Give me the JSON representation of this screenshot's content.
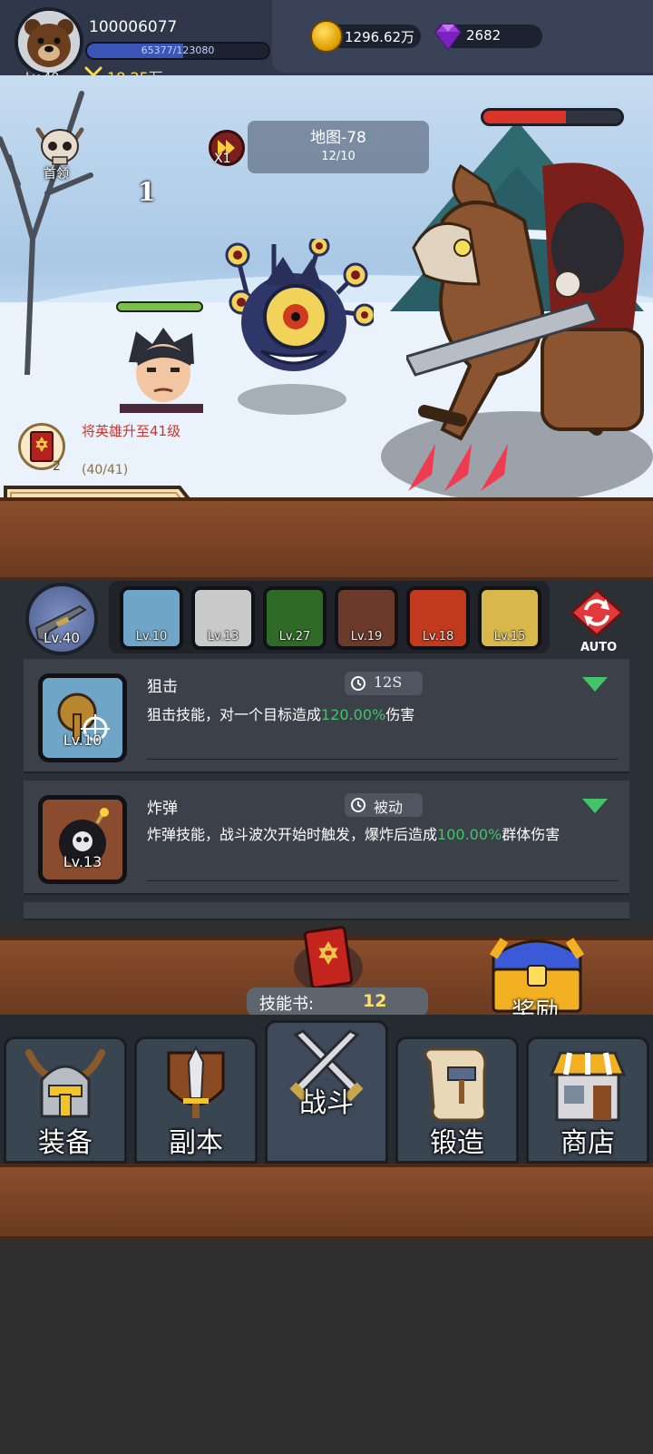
{
  "player": {
    "id": "100006077",
    "level": "Lv.40",
    "exp_text": "65377/123080",
    "exp_fraction": 0.531,
    "power": "18.25万"
  },
  "currency": {
    "gold": "1296.62万",
    "gems": "2682"
  },
  "battle": {
    "boss_label": "首领",
    "wave": "1",
    "speed": "X1",
    "map_title": "地图-78",
    "map_progress": "12/10",
    "boss_hp_fraction": 0.6,
    "hero_hp_fraction": 1.0
  },
  "quest": {
    "text": "将英雄升至41级",
    "progress": "(40/41)",
    "count": "2"
  },
  "skills_bar": {
    "weapon_level": "Lv.40",
    "slots": [
      {
        "level": "Lv.10",
        "color": "#6fa6c8"
      },
      {
        "level": "Lv.13",
        "color": "#c9c9c9"
      },
      {
        "level": "Lv.27",
        "color": "#2f6b26"
      },
      {
        "level": "Lv.19",
        "color": "#6b3a2a"
      },
      {
        "level": "Lv.18",
        "color": "#c23a1e"
      },
      {
        "level": "Lv.15",
        "color": "#d8b84a"
      }
    ],
    "auto_label": "AUTO"
  },
  "skill_list": [
    {
      "name": "狙击",
      "cooldown": "12S",
      "level": "Lv.10",
      "desc_before": "狙击技能，对一个目标造成",
      "desc_value": "120.00%",
      "desc_after": "伤害"
    },
    {
      "name": "炸弹",
      "cooldown": "被动",
      "level": "Lv.13",
      "desc_before": "炸弹技能，战斗波次开始时触发，爆炸后造成",
      "desc_value": "100.00%",
      "desc_after": "群体伤害"
    }
  ],
  "skillbook": {
    "label": "技能书:",
    "count": "12"
  },
  "reward": {
    "label": "奖励"
  },
  "nav": [
    {
      "label": "装备",
      "icon": "helmet-icon"
    },
    {
      "label": "副本",
      "icon": "sword-shield-icon"
    },
    {
      "label": "战斗",
      "icon": "crossed-swords-icon"
    },
    {
      "label": "锻造",
      "icon": "scroll-hammer-icon"
    },
    {
      "label": "商店",
      "icon": "shop-icon"
    }
  ],
  "colors": {
    "highlight": "#43c46a",
    "quest_red": "#d0322a",
    "gold": "#ffe066"
  }
}
